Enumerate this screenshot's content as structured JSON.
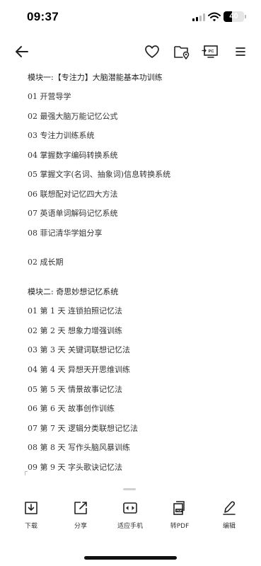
{
  "status_bar": {
    "time": "09:37",
    "battery_level": "40"
  },
  "nav": {
    "back_icon": "arrow-left-icon",
    "favorite_icon": "heart-icon",
    "folder_icon": "folder-location-icon",
    "cast_icon": "pc-screen-icon",
    "cast_label": "PC",
    "menu_icon": "menu-icon"
  },
  "document": {
    "lines": [
      "模块一:【专注力】大脑潜能基本功训练",
      "01 开营导学",
      "02 最强大脑万能记忆公式",
      "03 专注力训练系统",
      "04 掌握数字编码转换系统",
      "05 掌握文字(名词、抽象词)信息转换系统",
      "06 联想配对记忆四大方法",
      "07 英语单词解码记忆系统",
      "08 菲记清华学姐分享",
      "02 成长期",
      "模块二: 奇思妙想记忆系统",
      "01 第 1 天  连锁拍照记忆法",
      "02 第 2 天  想象力增强训练",
      "03 第 3 天  关键词联想记忆法",
      "04 第 4 天  异想天开思维训练",
      "05 第 5 天  情景故事记忆法",
      "06 第 6 天  故事创作训练",
      "07 第 7 天  逻辑分类联想记忆法",
      "08 第 8 天  写作头脑风暴训练",
      "09 第 9 天  字头歌诀记忆法"
    ]
  },
  "toolbar": {
    "items": [
      {
        "label": "下载",
        "icon": "download-icon"
      },
      {
        "label": "分享",
        "icon": "share-icon"
      },
      {
        "label": "适应手机",
        "icon": "fit-phone-icon"
      },
      {
        "label": "转PDF",
        "icon": "pdf-icon",
        "badge": "PDF"
      },
      {
        "label": "编辑",
        "icon": "edit-pen-icon"
      }
    ]
  }
}
